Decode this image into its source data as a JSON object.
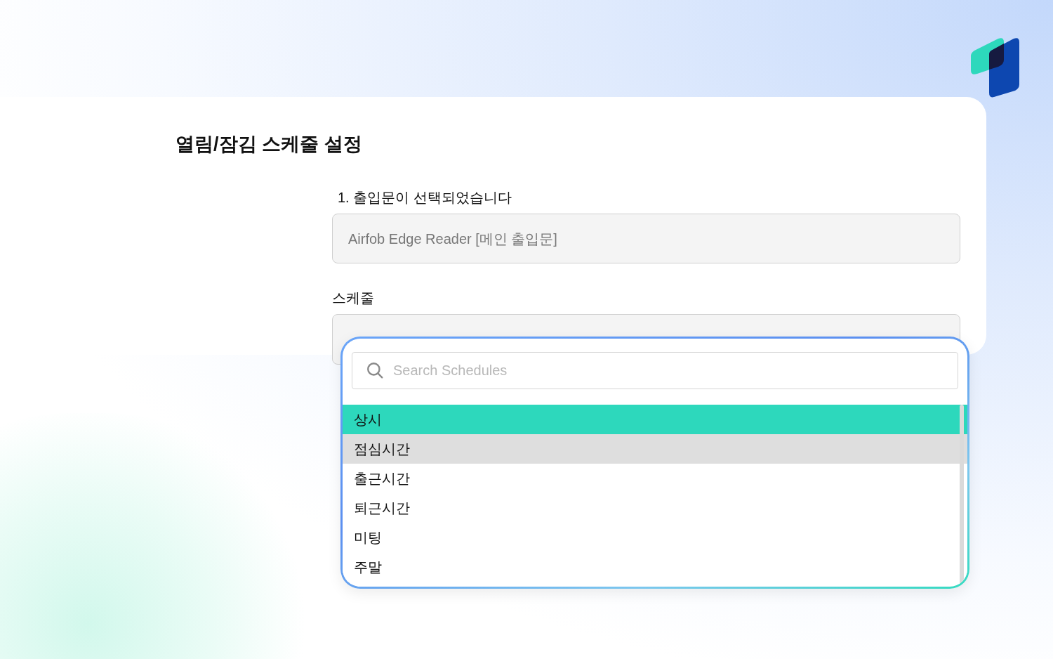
{
  "title": "열림/잠김 스케줄 설정",
  "door": {
    "label": "1. 출입문이 선택되었습니다",
    "value": "Airfob Edge Reader [메인 출입문]"
  },
  "schedule": {
    "label": "스케줄"
  },
  "dropdown": {
    "search": {
      "placeholder": "Search Schedules"
    },
    "items": [
      {
        "label": "상시",
        "selected": true,
        "highlighted": false
      },
      {
        "label": "점심시간",
        "selected": false,
        "highlighted": true
      },
      {
        "label": "출근시간",
        "selected": false,
        "highlighted": false
      },
      {
        "label": "퇴근시간",
        "selected": false,
        "highlighted": false
      },
      {
        "label": "미팅",
        "selected": false,
        "highlighted": false
      },
      {
        "label": "주말",
        "selected": false,
        "highlighted": false
      }
    ]
  }
}
